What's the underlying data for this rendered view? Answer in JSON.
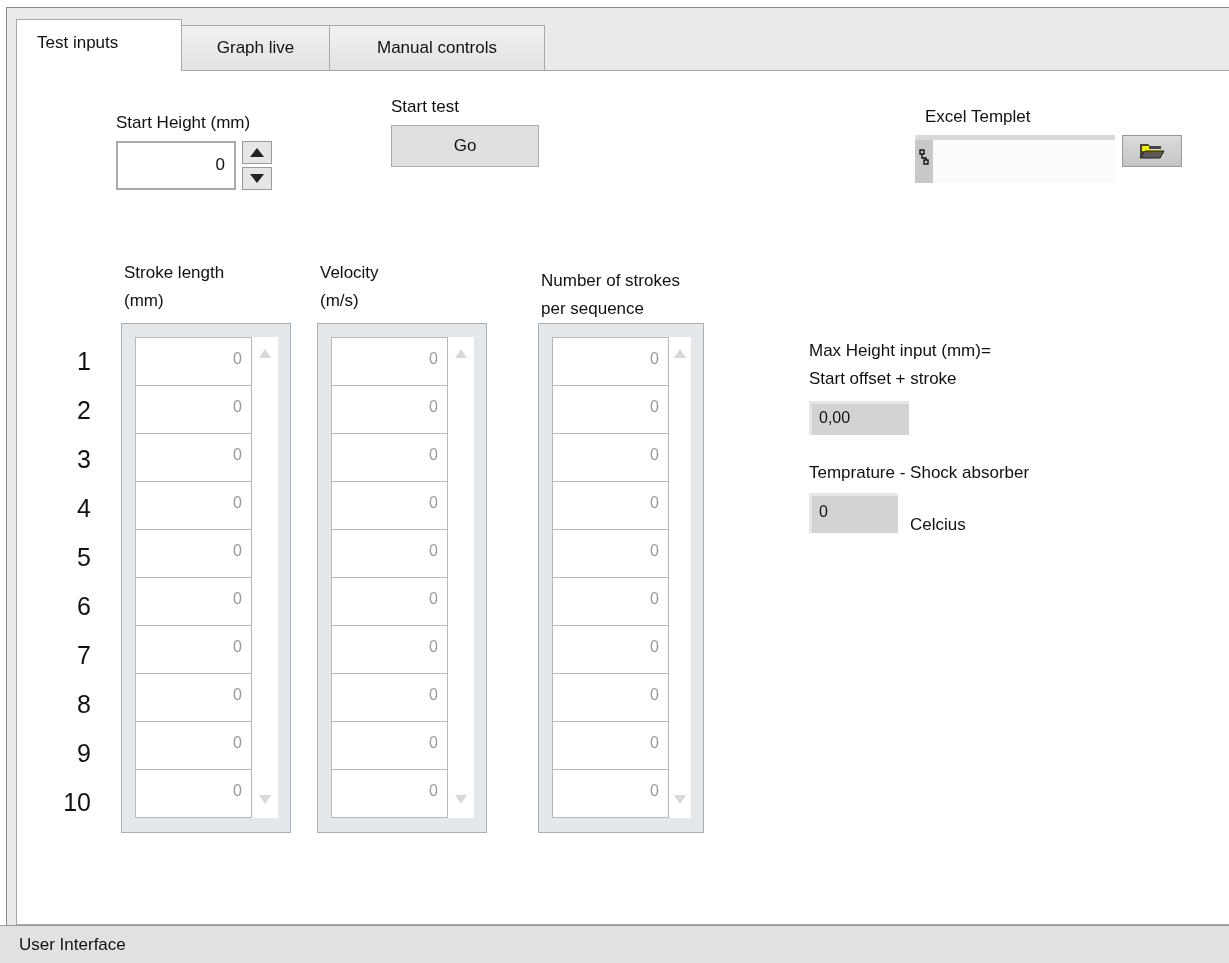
{
  "tabs": [
    {
      "label": "Test inputs",
      "selected": true
    },
    {
      "label": "Graph live",
      "selected": false
    },
    {
      "label": "Manual controls",
      "selected": false
    }
  ],
  "start_height": {
    "label": "Start Height (mm)",
    "value": "0"
  },
  "start_test": {
    "label": "Start test",
    "button": "Go"
  },
  "excel_template": {
    "label": "Excel Templet"
  },
  "row_numbers": [
    "1",
    "2",
    "3",
    "4",
    "5",
    "6",
    "7",
    "8",
    "9",
    "10"
  ],
  "arrays": [
    {
      "label": "Stroke length\n(mm)",
      "values": [
        "0",
        "0",
        "0",
        "0",
        "0",
        "0",
        "0",
        "0",
        "0",
        "0"
      ]
    },
    {
      "label": "Velocity\n(m/s)",
      "values": [
        "0",
        "0",
        "0",
        "0",
        "0",
        "0",
        "0",
        "0",
        "0",
        "0"
      ]
    },
    {
      "label": "Number of strokes\nper sequence",
      "values": [
        "0",
        "0",
        "0",
        "0",
        "0",
        "0",
        "0",
        "0",
        "0",
        "0"
      ]
    }
  ],
  "max_height": {
    "label": "Max Height input (mm)=\nStart offset + stroke",
    "value": "0,00"
  },
  "temperature": {
    "label": "Temprature - Shock absorber",
    "value": "0",
    "unit": "Celcius"
  },
  "status_bar": "User Interface"
}
